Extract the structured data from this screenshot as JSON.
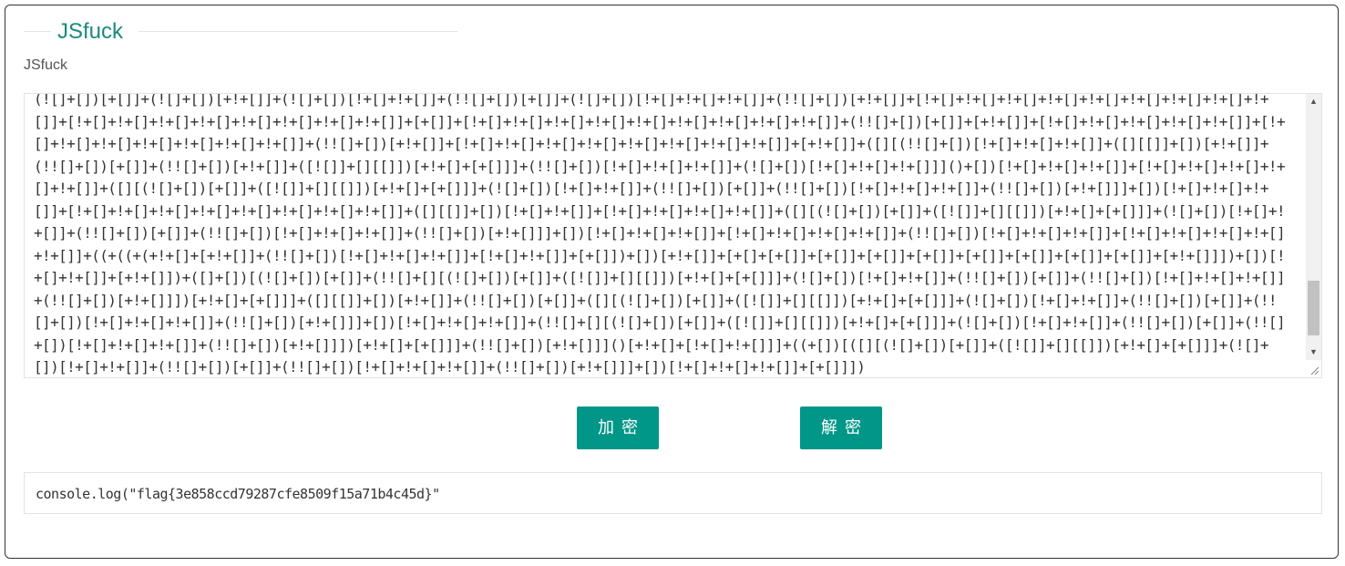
{
  "legend": {
    "title": "JSfuck"
  },
  "form": {
    "label": "JSfuck",
    "input_value": "(![]+[])[+[]]+(![]+[])[+!+[]]+(![]+[])[!+[]+!+[]]+(!![]+[])[+[]]+(![]+[])[!+[]+!+[]+!+[]]+(!![]+[])[+!+[]]+[!+[]+!+[]+!+[]+!+[]+!+[]+!+[]+!+[]+!+[]+!+[]]+[!+[]+!+[]+!+[]+!+[]+!+[]+!+[]+!+[]+!+[]]+[+[]]+[!+[]+!+[]+!+[]+!+[]+!+[]+!+[]+!+[]+!+[]+!+[]]+(!![]+[])[+[]]+[+!+[]]+[!+[]+!+[]+!+[]+!+[]+!+[]]+[!+[]+!+[]+!+[]+!+[]+!+[]+!+[]+!+[]]+(!![]+[])[+!+[]]+[!+[]+!+[]+!+[]+!+[]+!+[]+!+[]+!+[]+!+[]]+[+!+[]]+([][(!![]+[])[!+[]+!+[]+!+[]]+([][[]]+[])[+!+[]]+(!![]+[])[+[]]+(!![]+[])[+!+[]]+([![]]+[][[]])[+!+[]+[+[]]]+(!![]+[])[!+[]+!+[]+!+[]]+(![]+[])[!+[]+!+[]+!+[]]]()+[])[!+[]+!+[]+!+[]]+[!+[]+!+[]+!+[]+!+[]+!+[]]+([][(![]+[])[+[]]+([![]]+[][[]])[+!+[]+[+[]]]+(![]+[])[!+[]+!+[]]+(!![]+[])[+[]]+(!![]+[])[!+[]+!+[]+!+[]]+(!![]+[])[+!+[]]]+[])[!+[]+!+[]+!+[]]+[!+[]+!+[]+!+[]+!+[]+!+[]+!+[]+!+[]+!+[]]+([][[]]+[])[!+[]+!+[]]+[!+[]+!+[]+!+[]+!+[]]+([][(![]+[])[+[]]+([![]]+[][[]])[+!+[]+[+[]]]+(![]+[])[!+[]+!+[]]+(!![]+[])[+[]]+(!![]+[])[!+[]+!+[]+!+[]]+(!![]+[])[+!+[]]]+[])[!+[]+!+[]+!+[]]+[!+[]+!+[]+!+[]+!+[]]+(!![]+[])[!+[]+!+[]+!+[]]+[!+[]+!+[]+!+[]+!+[]+!+[]]+((+((+(+!+[]+[+!+[]]+(!![]+[])[!+[]+!+[]+!+[]]+[!+[]+!+[]]+[+[]])+[])[+!+[]]+[+[]+[+[]]+[+[]]+[+[]]+[+[]]+[+[]]+[+[]]+[+[]]+[+[]]+[+!+[]]])+[])[!+[]+!+[]]+[+!+[]])+([]+[])[(![]+[])[+[]]+(!![]+[][(![]+[])[+[]]+([![]]+[][[]])[+!+[]+[+[]]]+(![]+[])[!+[]+!+[]]+(!![]+[])[+[]]+(!![]+[])[!+[]+!+[]+!+[]]+(!![]+[])[+!+[]]])[+!+[]+[+[]]]+([][[]]+[])[+!+[]]+(!![]+[])[+[]]+([][(![]+[])[+[]]+([![]]+[][[]])[+!+[]+[+[]]]+(![]+[])[!+[]+!+[]]+(!![]+[])[+[]]+(!![]+[])[!+[]+!+[]+!+[]]+(!![]+[])[+!+[]]]+[])[!+[]+!+[]+!+[]]+(!![]+[][(![]+[])[+[]]+([![]]+[][[]])[+!+[]+[+[]]]+(![]+[])[!+[]+!+[]]+(!![]+[])[+[]]+(!![]+[])[!+[]+!+[]+!+[]]+(!![]+[])[+!+[]]])[+!+[]+[+[]]]+(!![]+[])[+!+[]]]()[+!+[]+[!+[]+!+[]]]+((+[])[([][(![]+[])[+[]]+([![]]+[][[]])[+!+[]+[+[]]]+(![]+[])[!+[]+!+[]]+(!![]+[])[+[]]+(!![]+[])[!+[]+!+[]+!+[]]+(!![]+[])[+!+[]]]+[])[!+[]+!+[]+!+[]]+[+[]]])"
  },
  "buttons": {
    "encrypt": "加密",
    "decrypt": "解密"
  },
  "output": {
    "value": "console.log(\"flag{3e858ccd79287cfe8509f15a71b4c45d}\""
  }
}
